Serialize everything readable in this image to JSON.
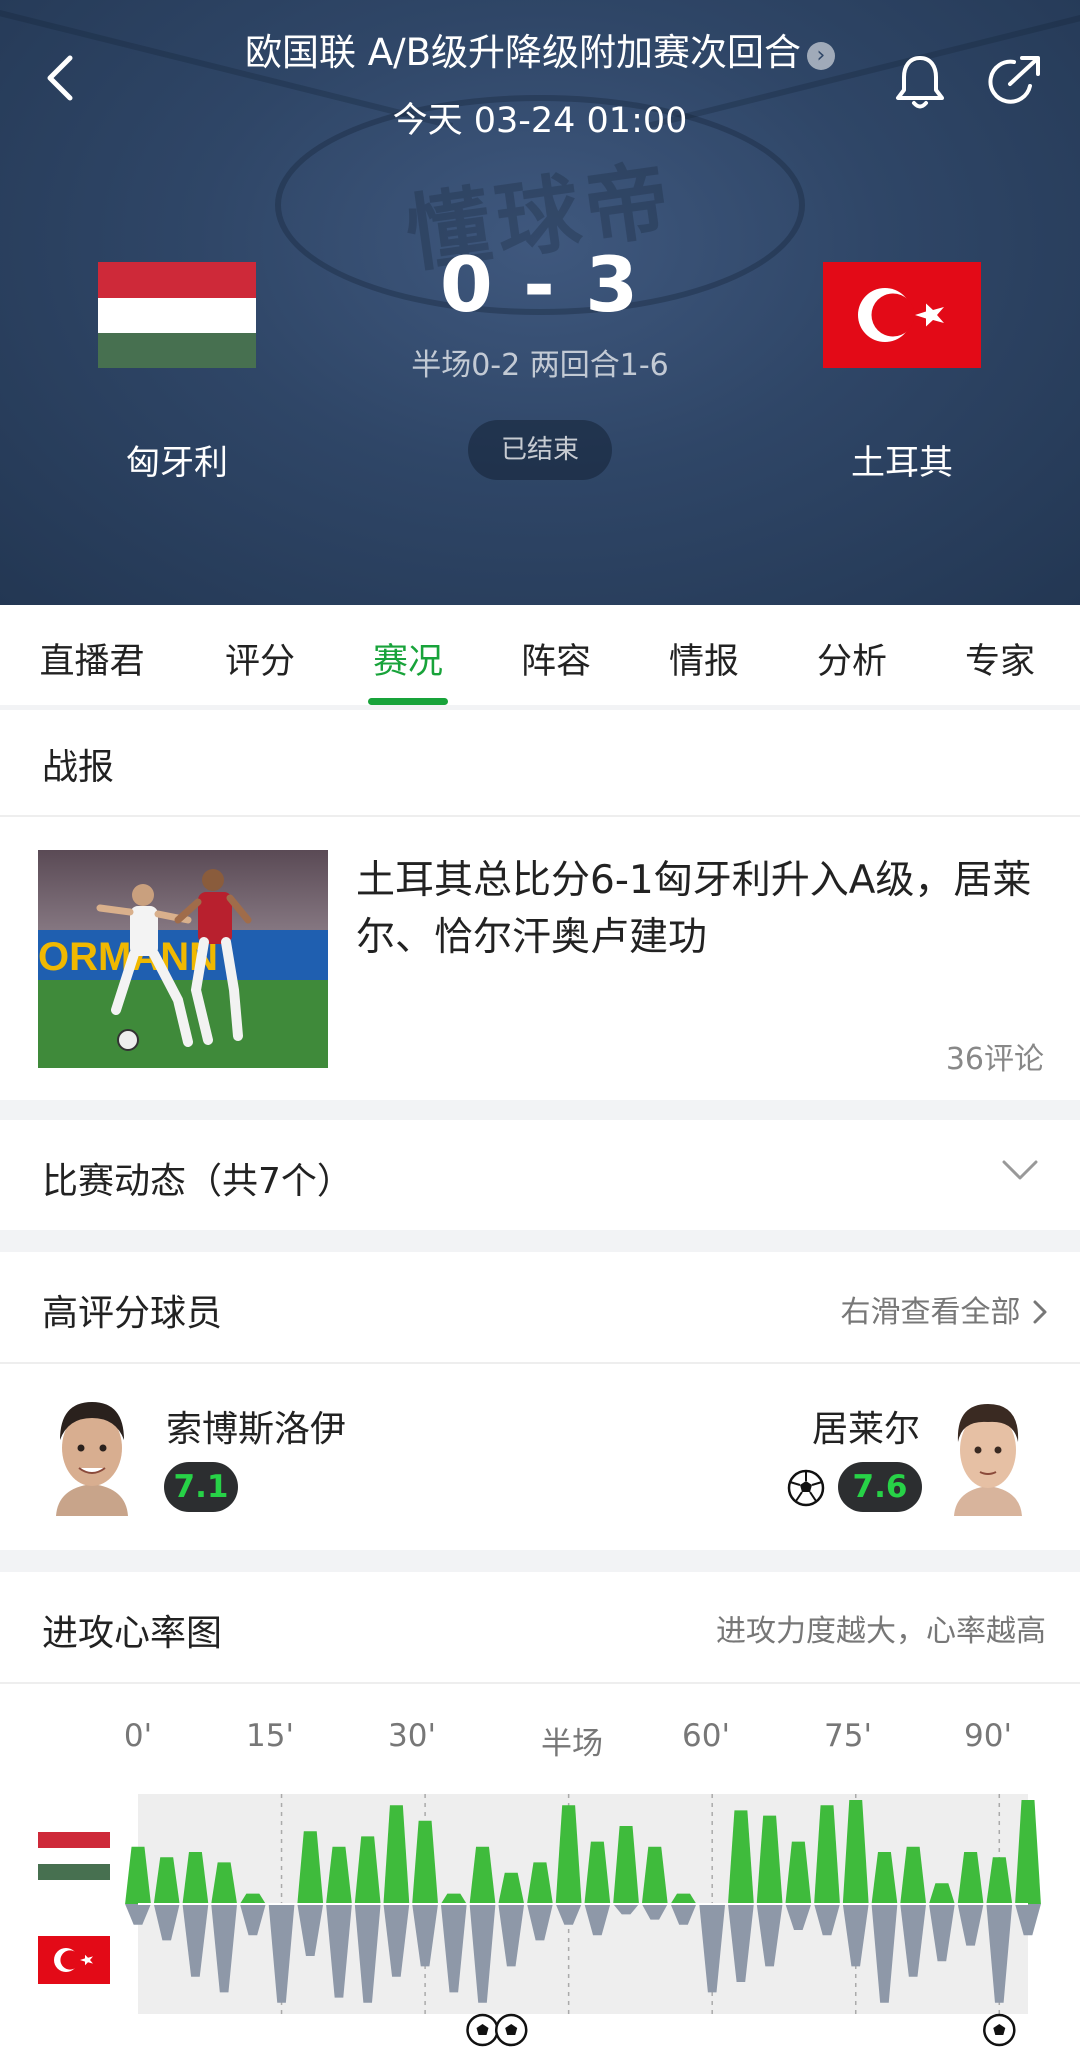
{
  "header": {
    "league_title": "欧国联 A/B级升降级附加赛次回合",
    "match_time": "今天 03-24 01:00",
    "watermark": "懂球帝",
    "home_team": "匈牙利",
    "away_team": "土耳其",
    "score": "0 - 3",
    "score_detail": "半场0-2 两回合1-6",
    "status": "已结束",
    "colors": {
      "background": "#2f4667",
      "home_flag": [
        "#ce2939",
        "#ffffff",
        "#477050"
      ],
      "away_flag": "#e30a17"
    }
  },
  "tabs": {
    "items": [
      {
        "label": "直播君"
      },
      {
        "label": "评分"
      },
      {
        "label": "赛况"
      },
      {
        "label": "阵容"
      },
      {
        "label": "情报"
      },
      {
        "label": "分析"
      },
      {
        "label": "专家"
      }
    ],
    "active_index": 2,
    "accent_color": "#18a33a"
  },
  "report": {
    "section_title": "战报",
    "headline": "土耳其总比分6-1匈牙利升入A级，居莱尔、恰尔汗奥卢建功",
    "comments": "36评论"
  },
  "events": {
    "title": "比赛动态（共7个）"
  },
  "top_players": {
    "title": "高评分球员",
    "view_all": "右滑查看全部",
    "home_player": {
      "name": "索博斯洛伊",
      "rating": "7.1"
    },
    "away_player": {
      "name": "居莱尔",
      "rating": "7.6",
      "icon": "goal-ball-icon"
    }
  },
  "heart_rate": {
    "title": "进攻心率图",
    "hint": "进攻力度越大，心率越高",
    "axis_labels": [
      "0'",
      "15'",
      "30'",
      "半场",
      "60'",
      "75'",
      "90'"
    ]
  },
  "chart_data": {
    "type": "area",
    "title": "进攻心率图",
    "x": [
      0,
      3,
      6,
      9,
      12,
      15,
      18,
      21,
      24,
      27,
      30,
      33,
      36,
      39,
      42,
      45,
      48,
      51,
      54,
      57,
      60,
      63,
      66,
      69,
      72,
      75,
      78,
      81,
      84,
      87,
      90,
      93
    ],
    "series": [
      {
        "values": [
          0.55,
          0.45,
          0.5,
          0.4,
          0.1,
          0,
          0.7,
          0.55,
          0.65,
          0.95,
          0.8,
          0.1,
          0.55,
          0.3,
          0.4,
          0.95,
          0.6,
          0.75,
          0.55,
          0.1,
          0,
          0.9,
          0.85,
          0.6,
          0.95,
          1.0,
          0.5,
          0.55,
          0.2,
          0.5,
          0.45,
          1.0
        ]
      },
      {
        "values": [
          -0.2,
          -0.35,
          -0.7,
          -0.85,
          -0.3,
          -0.95,
          -0.5,
          -0.9,
          -0.95,
          -0.7,
          -0.6,
          -0.85,
          -0.95,
          -0.6,
          -0.35,
          -0.2,
          -0.3,
          -0.1,
          -0.15,
          -0.2,
          -0.85,
          -0.75,
          -0.6,
          -0.25,
          -0.3,
          -0.6,
          -0.95,
          -0.7,
          -0.55,
          -0.4,
          -0.95,
          -0.3
        ]
      }
    ],
    "goal_markers": [
      {
        "minute": 36
      },
      {
        "minute": 39
      },
      {
        "minute": 90
      }
    ],
    "ylim": [
      -1,
      1
    ]
  }
}
